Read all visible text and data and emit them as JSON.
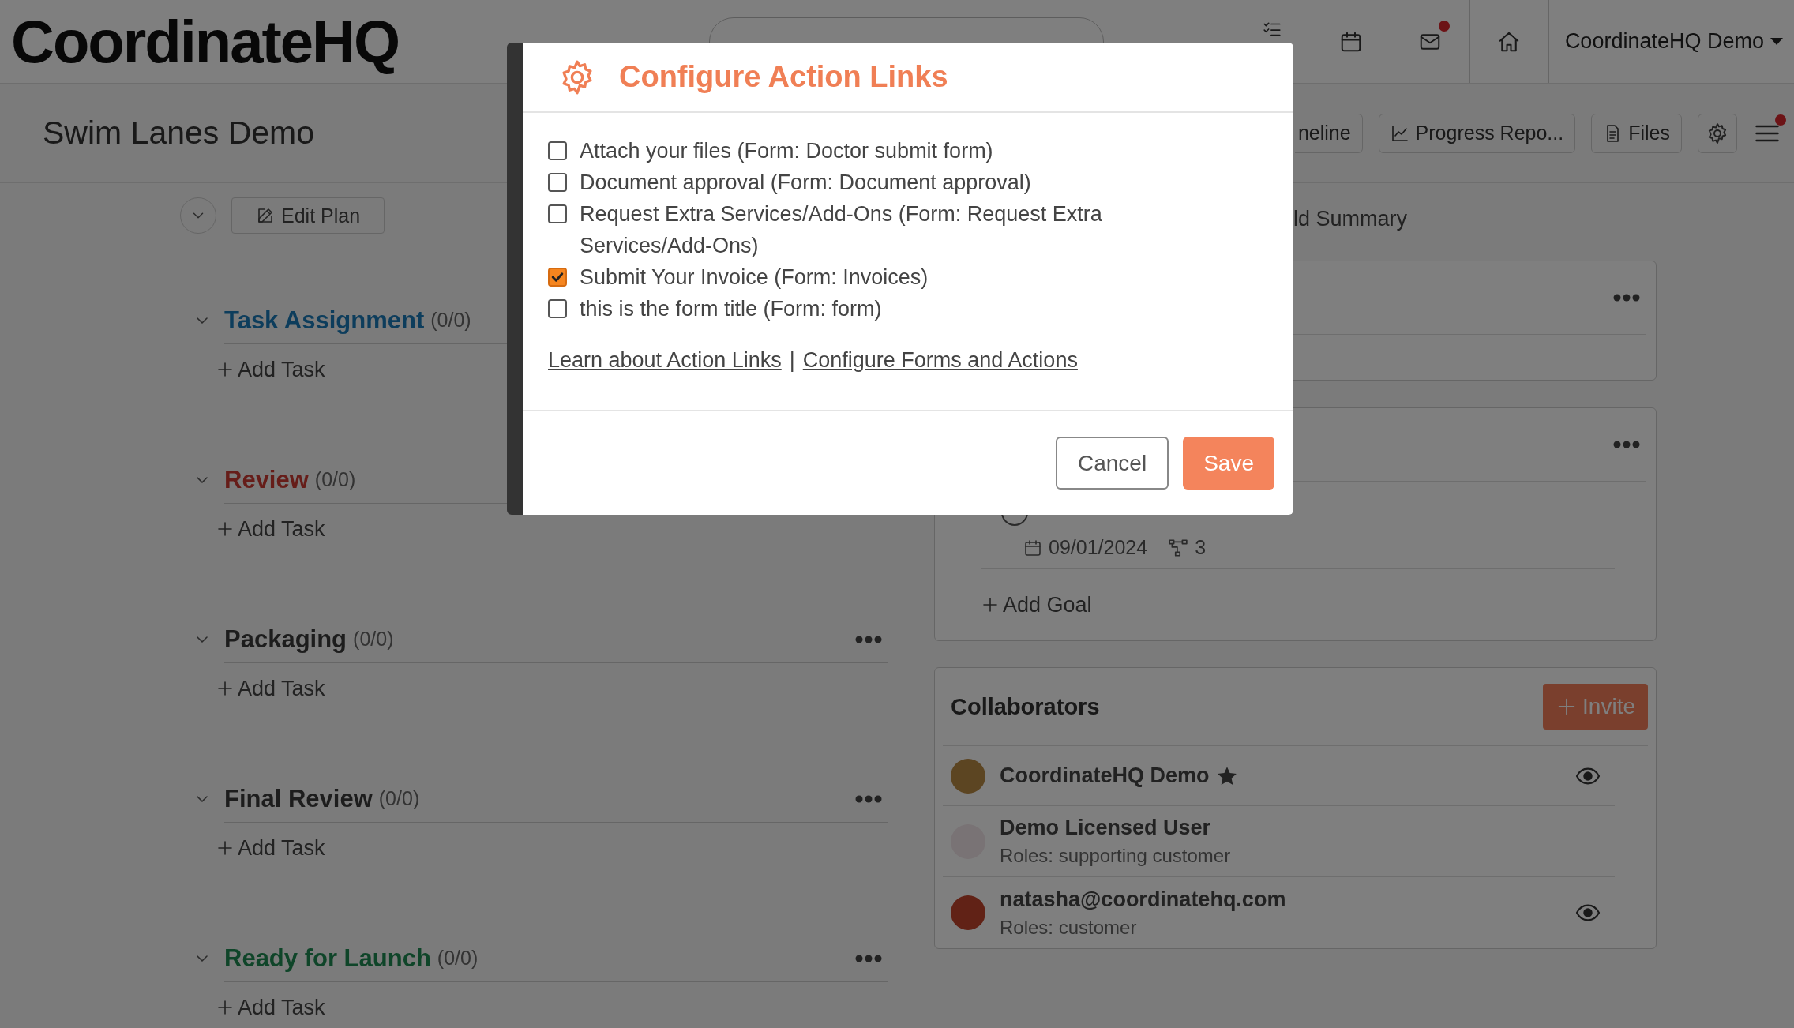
{
  "topbar": {
    "logo": "CoordinateHQ",
    "mail_unread": true,
    "user_menu": "CoordinateHQ Demo"
  },
  "page_header": {
    "title": "Swim Lanes Demo",
    "menu_alert": true,
    "buttons": [
      {
        "kind": "plain",
        "label": "neline"
      },
      {
        "kind": "chart",
        "label": "Progress Repo..."
      },
      {
        "kind": "document",
        "label": "Files"
      }
    ]
  },
  "plan": {
    "edit_button": "Edit Plan",
    "lanes": [
      {
        "title": "Task Assignment",
        "count": "(0/0)",
        "color": "#0d3d5c",
        "add_label": "Add Task"
      },
      {
        "title": "Review",
        "count": "(0/0)",
        "color": "#661d19",
        "add_label": "Add Task"
      },
      {
        "title": "Packaging",
        "count": "(0/0)",
        "color": "#1d1d1d",
        "add_label": "Add Task"
      },
      {
        "title": "Final Review",
        "count": "(0/0)",
        "color": "#1d1d1d",
        "add_label": "Add Task"
      },
      {
        "title": "Ready for Launch",
        "count": "(0/0)",
        "color": "#0f4529",
        "add_label": "Add Task"
      }
    ]
  },
  "summary": {
    "heading": "ld Summary",
    "goal": {
      "date": "09/01/2024",
      "subgoals": "3"
    },
    "add_goal": "Add Goal"
  },
  "collaborators": {
    "title": "Collaborators",
    "invite": "Invite",
    "people": [
      {
        "name": "CoordinateHQ Demo",
        "owner": true,
        "watching": true
      },
      {
        "name": "Demo Licensed User",
        "role": "Roles: supporting customer",
        "owner": false,
        "watching": false
      },
      {
        "name": "natasha@coordinatehq.com",
        "role": "Roles: customer",
        "owner": false,
        "watching": true
      }
    ]
  },
  "modal": {
    "title": "Configure Action Links",
    "options": [
      {
        "label": "Attach your files (Form: Doctor submit form)",
        "checked": false
      },
      {
        "label": "Document approval (Form: Document approval)",
        "checked": false
      },
      {
        "label": "Request Extra Services/Add-Ons (Form: Request Extra Services/Add-Ons)",
        "checked": false
      },
      {
        "label": "Submit Your Invoice (Form: Invoices)",
        "checked": true
      },
      {
        "label": "this is the form title (Form: form)",
        "checked": false
      }
    ],
    "links": [
      "Learn about Action Links",
      "Configure Forms and Actions"
    ],
    "link_separator": "|",
    "cancel": "Cancel",
    "save": "Save"
  }
}
